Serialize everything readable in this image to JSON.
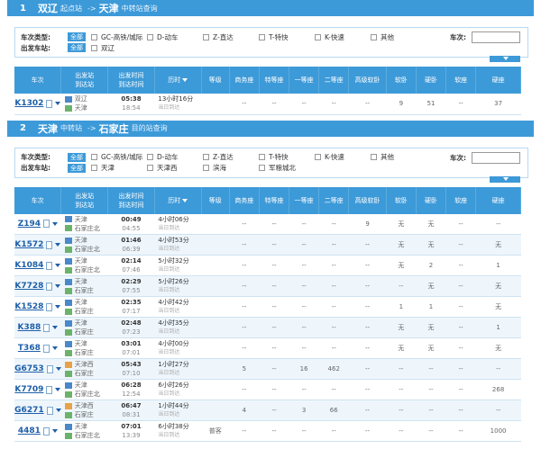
{
  "sections": [
    {
      "num": "1",
      "from": "双辽",
      "from_suffix": "起点站",
      "arrow": "->",
      "to": "天津",
      "to_suffix": "中转站查询",
      "filter": {
        "type_label": "车次类型:",
        "all": "全部",
        "types": [
          "GC-高铁/城际",
          "D-动车",
          "Z-直达",
          "T-特快",
          "K-快速",
          "其他"
        ],
        "dep_label": "出发车站:",
        "stations": [
          "双辽"
        ],
        "train_label": "车次:"
      },
      "headers": [
        "车次",
        "出发站\n到达站",
        "出发时间\n到达时间",
        "历时",
        "等级",
        "商务座",
        "特等座",
        "一等座",
        "二等座",
        "高级软卧",
        "软卧",
        "硬卧",
        "软座",
        "硬座"
      ],
      "rows": [
        {
          "no": "K1302",
          "from": "双辽",
          "to": "天津",
          "dep": "05:38",
          "arr": "18:54",
          "dur": "13小时16分",
          "day": "当日到达",
          "grade": "",
          "seats": [
            "--",
            "--",
            "--",
            "--",
            "--",
            "9",
            "51",
            "--",
            "37"
          ]
        }
      ]
    },
    {
      "num": "2",
      "from": "天津",
      "from_suffix": "中转站",
      "arrow": "->",
      "to": "石家庄",
      "to_suffix": "目的站查询",
      "filter": {
        "type_label": "车次类型:",
        "all": "全部",
        "types": [
          "GC-高铁/城际",
          "D-动车",
          "Z-直达",
          "T-特快",
          "K-快速",
          "其他"
        ],
        "dep_label": "出发车站:",
        "stations": [
          "天津",
          "天津西",
          "滨海",
          "军粮城北"
        ],
        "train_label": "车次:"
      },
      "headers": [
        "车次",
        "出发站\n到达站",
        "出发时间\n到达时间",
        "历时",
        "等级",
        "商务座",
        "特等座",
        "一等座",
        "二等座",
        "高级软卧",
        "软卧",
        "硬卧",
        "软座",
        "硬座"
      ],
      "rows": [
        {
          "no": "Z194",
          "from": "天津",
          "to": "石家庄北",
          "dep": "00:49",
          "arr": "04:55",
          "dur": "4小时06分",
          "day": "当日到达",
          "grade": "",
          "seats": [
            "--",
            "--",
            "--",
            "--",
            "9",
            "无",
            "无",
            "--",
            "--"
          ]
        },
        {
          "no": "K1572",
          "from": "天津",
          "to": "石家庄北",
          "dep": "01:46",
          "arr": "06:39",
          "dur": "4小时53分",
          "day": "当日到达",
          "grade": "",
          "seats": [
            "--",
            "--",
            "--",
            "--",
            "--",
            "无",
            "无",
            "--",
            "无"
          ]
        },
        {
          "no": "K1084",
          "from": "天津",
          "to": "石家庄北",
          "dep": "02:14",
          "arr": "07:46",
          "dur": "5小时32分",
          "day": "当日到达",
          "grade": "",
          "seats": [
            "--",
            "--",
            "--",
            "--",
            "--",
            "无",
            "2",
            "--",
            "1"
          ]
        },
        {
          "no": "K7728",
          "from": "天津",
          "to": "石家庄",
          "dep": "02:29",
          "arr": "07:55",
          "dur": "5小时26分",
          "day": "当日到达",
          "grade": "",
          "seats": [
            "--",
            "--",
            "--",
            "--",
            "--",
            "--",
            "无",
            "--",
            "无"
          ]
        },
        {
          "no": "K1528",
          "from": "天津",
          "to": "石家庄",
          "dep": "02:35",
          "arr": "07:17",
          "dur": "4小时42分",
          "day": "当日到达",
          "grade": "",
          "seats": [
            "--",
            "--",
            "--",
            "--",
            "--",
            "1",
            "1",
            "--",
            "无"
          ]
        },
        {
          "no": "K388",
          "from": "天津",
          "to": "石家庄",
          "dep": "02:48",
          "arr": "07:23",
          "dur": "4小时35分",
          "day": "当日到达",
          "grade": "",
          "seats": [
            "--",
            "--",
            "--",
            "--",
            "--",
            "无",
            "无",
            "--",
            "1"
          ]
        },
        {
          "no": "T368",
          "from": "天津",
          "to": "石家庄",
          "dep": "03:01",
          "arr": "07:01",
          "dur": "4小时00分",
          "day": "当日到达",
          "grade": "",
          "seats": [
            "--",
            "--",
            "--",
            "--",
            "--",
            "无",
            "无",
            "--",
            "无"
          ]
        },
        {
          "no": "G6753",
          "from": "天津西",
          "to": "石家庄",
          "dep": "05:43",
          "arr": "07:10",
          "dur": "1小时27分",
          "day": "当日到达",
          "grade": "",
          "seats": [
            "5",
            "--",
            "16",
            "462",
            "--",
            "--",
            "--",
            "--",
            "--"
          ]
        },
        {
          "no": "K7709",
          "from": "天津",
          "to": "石家庄北",
          "dep": "06:28",
          "arr": "12:54",
          "dur": "6小时26分",
          "day": "当日到达",
          "grade": "",
          "seats": [
            "--",
            "--",
            "--",
            "--",
            "--",
            "--",
            "--",
            "--",
            "268"
          ]
        },
        {
          "no": "G6271",
          "from": "天津西",
          "to": "石家庄",
          "dep": "06:47",
          "arr": "08:31",
          "dur": "1小时44分",
          "day": "当日到达",
          "grade": "",
          "seats": [
            "4",
            "--",
            "3",
            "66",
            "--",
            "--",
            "--",
            "--",
            "--"
          ]
        },
        {
          "no": "4481",
          "from": "天津",
          "to": "石家庄北",
          "dep": "07:01",
          "arr": "13:39",
          "dur": "6小时38分",
          "day": "当日到达",
          "grade": "普客",
          "seats": [
            "--",
            "--",
            "--",
            "--",
            "--",
            "--",
            "--",
            "--",
            "1000"
          ]
        }
      ]
    }
  ],
  "colors": {
    "accent": "#3d9ad8",
    "train_link": "#1e5fa8",
    "row_alt": "#eef6fc"
  }
}
